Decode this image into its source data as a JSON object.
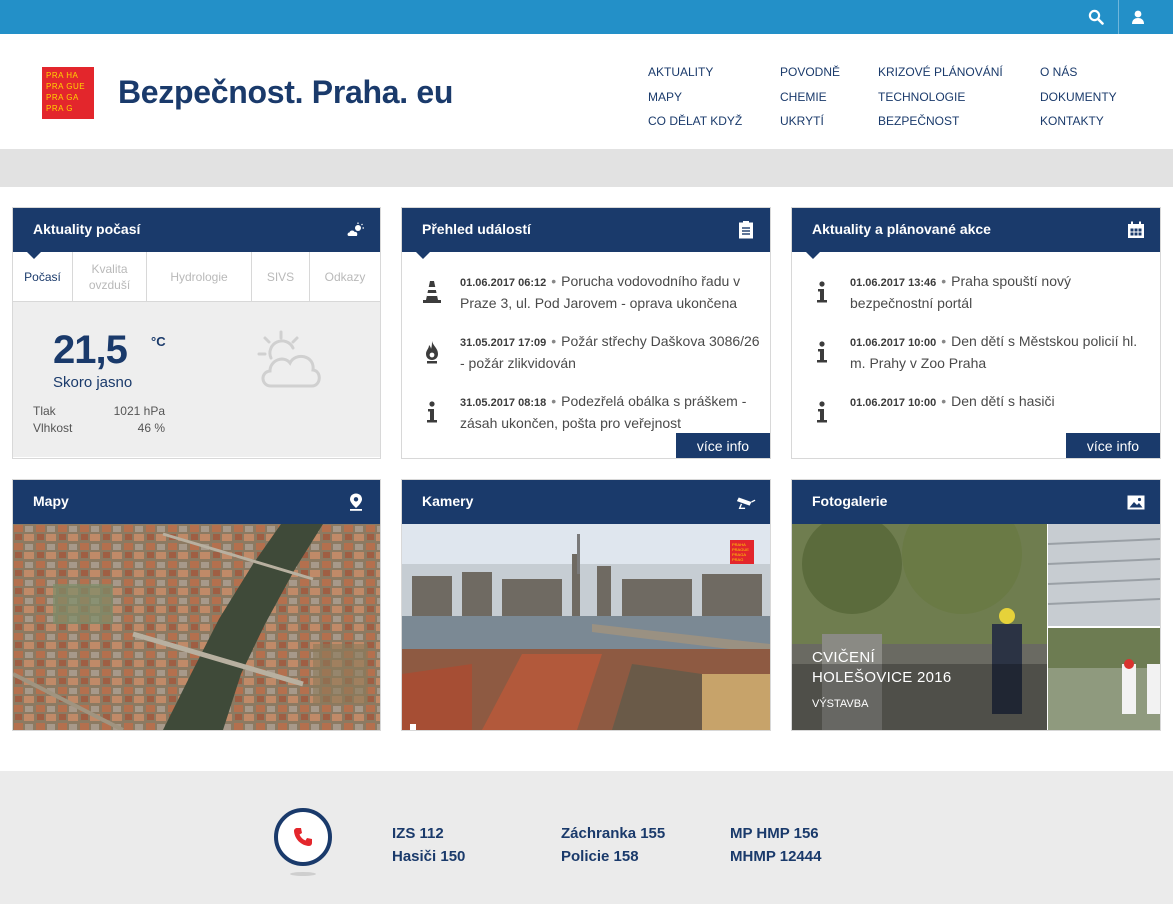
{
  "topbar": {
    "search_icon": "search-icon",
    "user_icon": "user-icon"
  },
  "logo": {
    "lines": [
      "PRA HA",
      "PRA GUE",
      "PRA GA",
      "PRA G"
    ]
  },
  "site_title": "Bezpečnost. Praha. eu",
  "nav": {
    "col1": [
      "AKTUALITY",
      "MAPY",
      "CO DĚLAT KDYŽ"
    ],
    "col2": [
      "POVODNĚ",
      "CHEMIE",
      "UKRYTÍ"
    ],
    "col3": [
      "KRIZOVÉ PLÁNOVÁNÍ",
      "TECHNOLOGIE",
      "BEZPEČNOST"
    ],
    "col4": [
      "O NÁS",
      "DOKUMENTY",
      "KONTAKTY"
    ]
  },
  "weather": {
    "title": "Aktuality počasí",
    "tabs": [
      "Počasí",
      "Kvalita ovzduší",
      "Hydrologie",
      "SIVS",
      "Odkazy"
    ],
    "temperature": "21,5",
    "unit": "°C",
    "description": "Skoro jasno",
    "pressure_label": "Tlak",
    "pressure_value": "1021 hPa",
    "humidity_label": "Vlhkost",
    "humidity_value": "46 %"
  },
  "events": {
    "title": "Přehled událostí",
    "items": [
      {
        "date": "01.06.2017 06:12",
        "text": "Porucha vodovodního řadu v Praze 3, ul. Pod Jarovem - oprava ukončena",
        "icon": "traffic-cone-icon"
      },
      {
        "date": "31.05.2017 17:09",
        "text": "Požár střechy Daškova 3086/26 - požár zlikvidován",
        "icon": "fire-icon"
      },
      {
        "date": "31.05.2017 08:18",
        "text": "Podezřelá obálka s práškem - zásah ukončen, pošta pro veřejnost",
        "icon": "info-icon"
      }
    ],
    "more": "více info"
  },
  "actions": {
    "title": "Aktuality a plánované akce",
    "items": [
      {
        "date": "01.06.2017 13:46",
        "text": "Praha spouští nový bezpečnostní portál"
      },
      {
        "date": "01.06.2017 10:00",
        "text": "Den dětí s Městskou policií hl. m. Prahy v Zoo Praha"
      },
      {
        "date": "01.06.2017 10:00",
        "text": "Den dětí s hasiči"
      }
    ],
    "more": "více info"
  },
  "maps": {
    "title": "Mapy"
  },
  "cameras": {
    "title": "Kamery",
    "logo_lines": [
      "PRAHA",
      "PRAGUE",
      "PRAGA",
      "PRAG"
    ]
  },
  "gallery": {
    "title": "Fotogalerie",
    "caption_line1": "CVIČENÍ",
    "caption_line2": "HOLEŠOVICE 2016",
    "caption_sub": "VÝSTAVBA"
  },
  "footer": {
    "col1": [
      "IZS 112",
      "Hasiči 150"
    ],
    "col2": [
      "Záchranka 155",
      "Policie 158"
    ],
    "col3": [
      "MP HMP 156",
      "MHMP 12444"
    ]
  },
  "colors": {
    "accent": "#2390c8",
    "navy": "#1a3a6b",
    "brand_red": "#e3262c",
    "brand_yellow": "#ffd400"
  }
}
